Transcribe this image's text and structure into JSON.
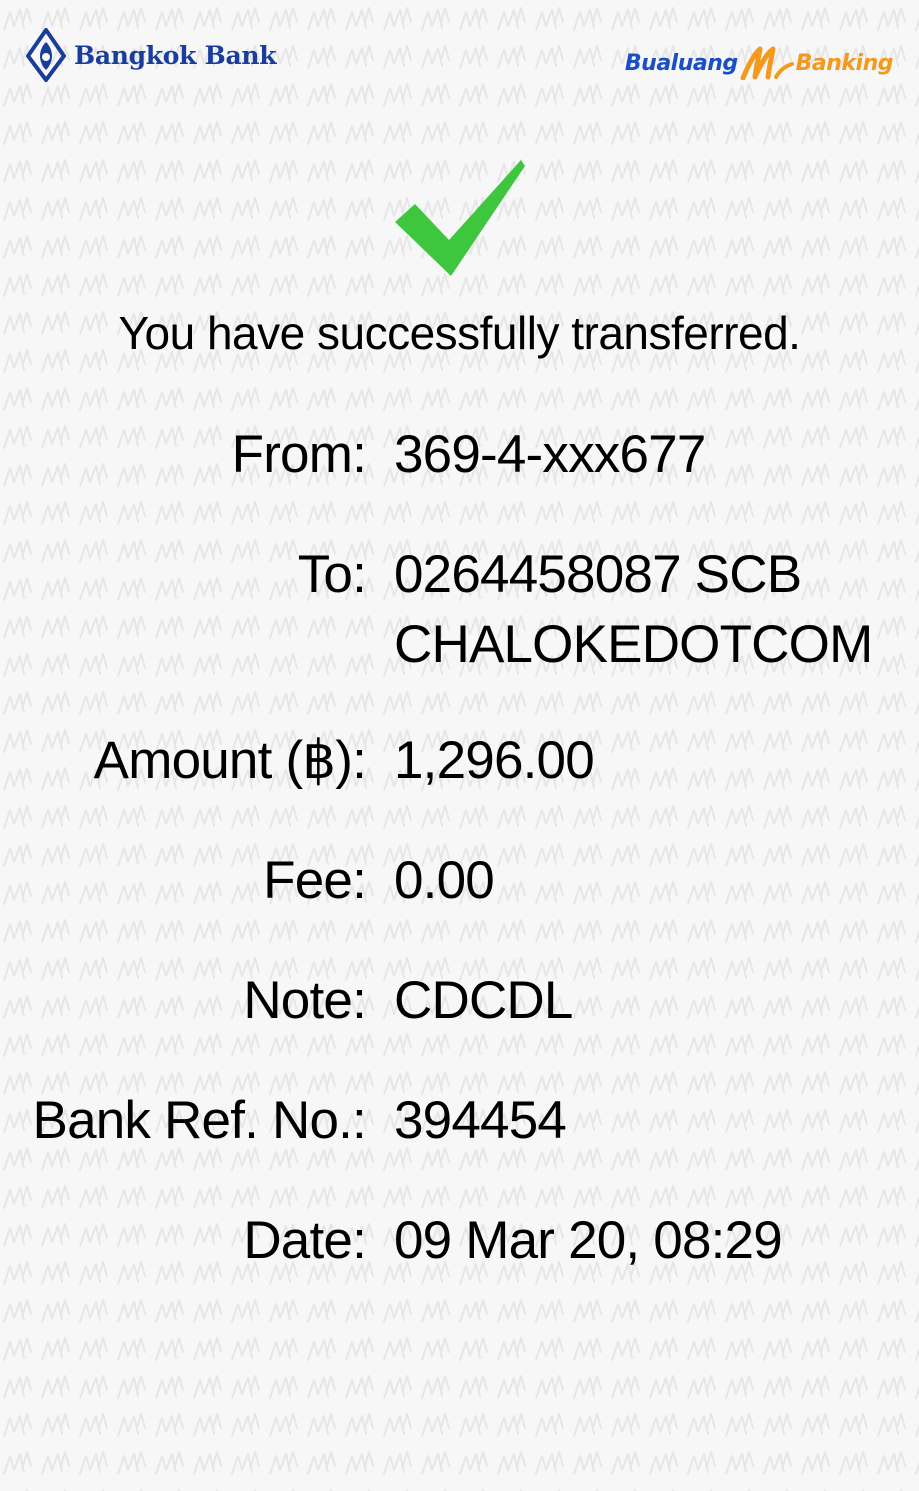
{
  "header": {
    "bank_name": "Bangkok Bank",
    "app_logo": {
      "left": "Bualuang",
      "right": "Banking"
    }
  },
  "status": {
    "icon": "checkmark-icon",
    "message": "You have successfully transferred."
  },
  "details": {
    "from": {
      "label": "From:",
      "value": "369-4-xxx677"
    },
    "to": {
      "label": "To:",
      "value_line1": "0264458087 SCB",
      "value_line2": "CHALOKEDOTCOM"
    },
    "amount": {
      "label": "Amount (฿):",
      "value": "1,296.00"
    },
    "fee": {
      "label": "Fee:",
      "value": "0.00"
    },
    "note": {
      "label": "Note:",
      "value": "CDCDL"
    },
    "bank_ref": {
      "label": "Bank Ref. No.:",
      "value": "394454"
    },
    "date": {
      "label": "Date:",
      "value": "09 Mar 20, 08:29"
    }
  },
  "colors": {
    "brand_blue": "#1a3d9c",
    "mbanking_blue": "#1a4fc4",
    "mbanking_orange": "#f39a1e",
    "check_green": "#3fc63f",
    "background": "#f7f7f7"
  }
}
